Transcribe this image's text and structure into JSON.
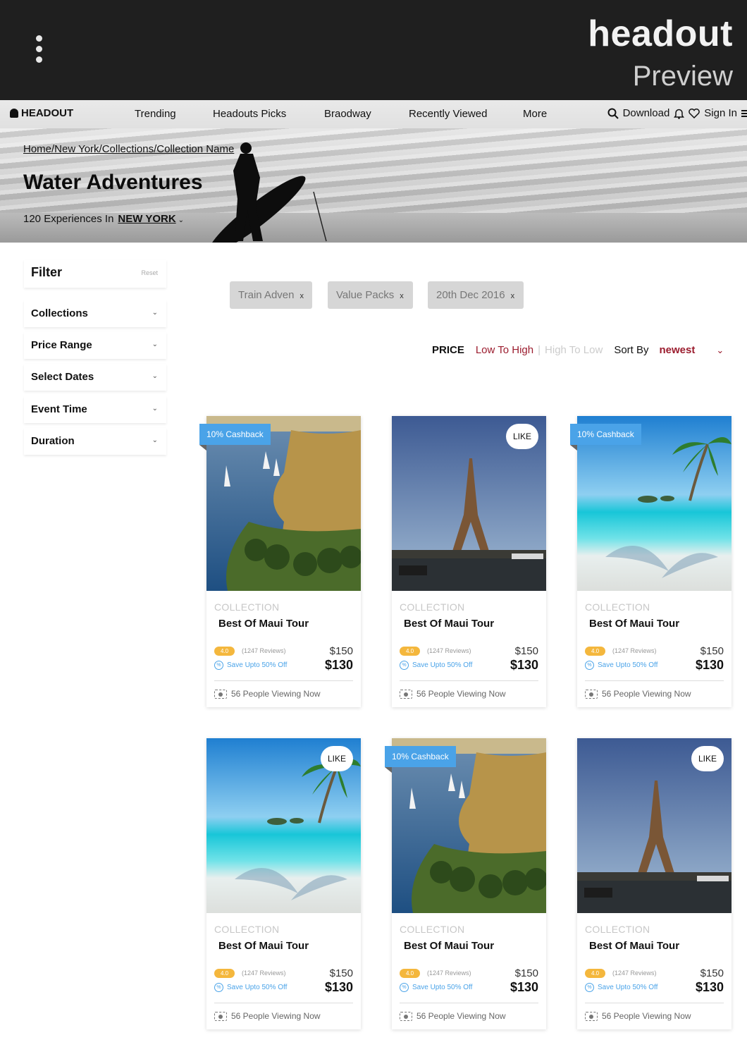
{
  "preview": {
    "brand": "headout",
    "label": "Preview",
    "menu_icon": "kebab-menu-icon"
  },
  "nav": {
    "logo": "HEADOUT",
    "items": [
      "Trending",
      "Headouts Picks",
      "Braodway",
      "Recently Viewed",
      "More"
    ],
    "download": "Download",
    "signin": "Sign In"
  },
  "hero": {
    "breadcrumb": "Home/New York/Collections/Collection Name",
    "title": "Water Adventures",
    "count": "120 Experiences In",
    "city": "NEW YORK"
  },
  "filter": {
    "title": "Filter",
    "reset": "Reset",
    "items": [
      "Collections",
      "Price Range",
      "Select Dates",
      "Event Time",
      "Duration"
    ]
  },
  "chips": [
    "Train Adven",
    "Value Packs",
    "20th Dec 2016"
  ],
  "chip_close": "x",
  "sort": {
    "price_label": "PRICE",
    "low_to_high": "Low To High",
    "separator": "|",
    "high_to_low": "High To Low",
    "sort_by": "Sort By",
    "value": "newest"
  },
  "colors": {
    "accent": "#9b1c2e",
    "cashback": "#4aa3e8",
    "rating": "#f4b73d"
  },
  "cards": [
    {
      "image": "nile-river",
      "badge": "10% Cashback",
      "label": "COLLECTION",
      "name": "Best Of Maui Tour",
      "rating": "4.0",
      "reviews": "(1247 Reviews)",
      "save": "Save Upto 50% Off",
      "old_price": "$150",
      "price": "$130",
      "viewing": "56 People Viewing Now"
    },
    {
      "image": "eiffel-tower",
      "badge": "LIKE",
      "label": "COLLECTION",
      "name": "Best Of Maui Tour",
      "rating": "4.0",
      "reviews": "(1247 Reviews)",
      "save": "Save Upto 50% Off",
      "old_price": "$150",
      "price": "$130",
      "viewing": "56 People Viewing Now"
    },
    {
      "image": "tropical-beach",
      "badge": "10% Cashback",
      "label": "COLLECTION",
      "name": "Best Of Maui Tour",
      "rating": "4.0",
      "reviews": "(1247 Reviews)",
      "save": "Save Upto 50% Off",
      "old_price": "$150",
      "price": "$130",
      "viewing": "56 People Viewing Now"
    },
    {
      "image": "tropical-beach",
      "badge": "LIKE",
      "label": "COLLECTION",
      "name": "Best Of Maui Tour",
      "rating": "4.0",
      "reviews": "(1247 Reviews)",
      "save": "Save Upto 50% Off",
      "old_price": "$150",
      "price": "$130",
      "viewing": "56 People Viewing Now"
    },
    {
      "image": "nile-river",
      "badge": "10% Cashback",
      "label": "COLLECTION",
      "name": "Best Of Maui Tour",
      "rating": "4.0",
      "reviews": "(1247 Reviews)",
      "save": "Save Upto 50% Off",
      "old_price": "$150",
      "price": "$130",
      "viewing": "56 People Viewing Now"
    },
    {
      "image": "eiffel-tower",
      "badge": "LIKE",
      "label": "COLLECTION",
      "name": "Best Of Maui Tour",
      "rating": "4.0",
      "reviews": "(1247 Reviews)",
      "save": "Save Upto 50% Off",
      "old_price": "$150",
      "price": "$130",
      "viewing": "56 People Viewing Now"
    }
  ]
}
